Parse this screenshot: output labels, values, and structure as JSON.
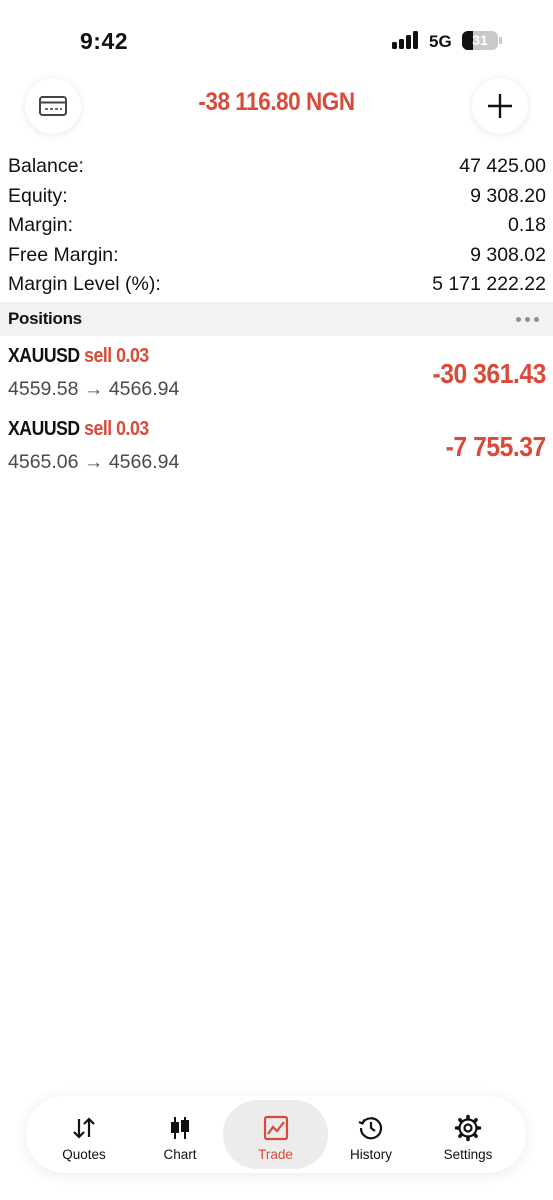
{
  "status_bar": {
    "time": "9:42",
    "network": "5G",
    "battery": "31",
    "battery_level": 0.31
  },
  "header": {
    "title": "-38 116.80 NGN",
    "left_icon": "card-icon",
    "right_icon": "plus-icon"
  },
  "summary": [
    {
      "label": "Balance:",
      "value": "47 425.00"
    },
    {
      "label": "Equity:",
      "value": "9 308.20"
    },
    {
      "label": "Margin:",
      "value": "0.18"
    },
    {
      "label": "Free Margin:",
      "value": "9 308.02"
    },
    {
      "label": "Margin Level (%):",
      "value": "5 171 222.22"
    }
  ],
  "positions_section": {
    "title": "Positions",
    "more_icon": "ellipsis-icon"
  },
  "positions": [
    {
      "symbol": "XAUUSD",
      "side": "sell 0.03",
      "prices": "4559.58 → 4566.94",
      "profit": "-30 361.43"
    },
    {
      "symbol": "XAUUSD",
      "side": "sell 0.03",
      "prices": "4565.06 → 4566.94",
      "profit": "-7 755.37"
    }
  ],
  "tabs": [
    {
      "label": "Quotes",
      "icon": "sort-arrows-icon",
      "active": false
    },
    {
      "label": "Chart",
      "icon": "candlestick-icon",
      "active": false
    },
    {
      "label": "Trade",
      "icon": "trade-chart-icon",
      "active": true
    },
    {
      "label": "History",
      "icon": "history-clock-icon",
      "active": false
    },
    {
      "label": "Settings",
      "icon": "gear-icon",
      "active": false
    }
  ],
  "colors": {
    "accent": "#d94a38",
    "text": "#111111",
    "muted": "#4a4a4a",
    "section_bg": "#f2f2f2"
  }
}
